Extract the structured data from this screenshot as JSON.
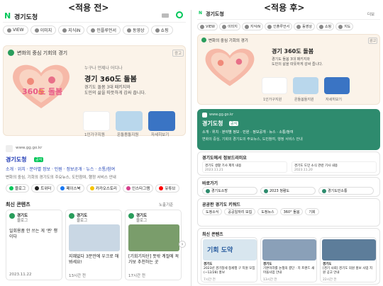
{
  "captions": {
    "before": "<적용 전>",
    "after": "<적용 후>"
  },
  "left": {
    "search": {
      "logo": "N",
      "query": "경기도청"
    },
    "tabs": [
      "VIEW",
      "이미지",
      "지식iN",
      "인플루언서",
      "동영상",
      "쇼핑"
    ],
    "banner": {
      "label": "변화의 중심 기회의 경기",
      "ad": "광고",
      "tagline": "누구나 언제나 어디나",
      "heading": "경기 360도 돌봄",
      "desc": "경기도 돌봄 3대 패키지와\n도민의 삶을 따뜻하게 감싸 줍니다.",
      "art": "360도 돌봄",
      "items": [
        "1인가구지원",
        "온돌봄돌지원",
        "자세히보기"
      ]
    },
    "site": {
      "url": "www.gg.go.kr",
      "name": "경기도청",
      "badge": "공식",
      "links": "소개 · 위치 · 분야별 정보 · 민원 · 정보공개 · 뉴스 · 소통/참여",
      "desc": "변화의 중심, 기회의 경기도의 주요뉴스, 도민참여, 행정 서비스 안내",
      "socials": [
        "블로그",
        "트위터",
        "페이스북",
        "카카오스토리",
        "인스타그램",
        "유튜브"
      ]
    },
    "content": {
      "title": "최신 콘텐츠",
      "more": "노출기준",
      "cards": [
        {
          "source": "경기도",
          "type": "블로그",
          "text": "일회용품 안 쓰는 게 '찐' 챙이다",
          "date": "2023.11.22"
        },
        {
          "source": "경기도",
          "type": "블로그",
          "text": "지혜없다 3분만에 우크로 해봐세요!",
          "date": "13시간 전"
        },
        {
          "source": "경기도",
          "type": "블로그",
          "text": "[기회기자단] 뜻밖 계절에 꼭 가보 추천하는 곳",
          "date": "17시간 전"
        }
      ]
    }
  },
  "right": {
    "search": {
      "logo": "N",
      "query": "경기도청",
      "extra": "더보"
    },
    "tabs": [
      "VIEW",
      "이미지",
      "지식iN",
      "인플루언서",
      "동영상",
      "쇼핑",
      "지도"
    ],
    "banner": {
      "label": "변화의 중심 기회의 경기",
      "ad": "광고",
      "heading": "경기 360도 돌봄",
      "desc": "경기도 돌봄 3대 패키지와\n도민의 삶을 따뜻하게 감싸 줍니다.",
      "items": [
        "1인가구지원",
        "온돌봄돌지원",
        "자세히보기"
      ]
    },
    "site": {
      "url": "www.gg.go.kr",
      "name": "경기도청",
      "badge": "공식",
      "links": "소개 · 위치 · 분야별 정보 · 민원 · 정보공개 · 뉴스 · 소통/참여",
      "desc": "변화의 중심, 기회의 경기도의 주요뉴스, 도민참여, 행정 서비스 안내"
    },
    "news": {
      "title": "경기도에서 정보드리미요",
      "items": [
        {
          "text": "경기도 생활 기사 제목 내용",
          "date": "2023.11.21"
        },
        {
          "text": "경기도 도민 소식 관련 기사 내용",
          "date": "2023.11.20"
        }
      ]
    },
    "shortcuts": {
      "title": "바로가기",
      "items": [
        "경기도소방",
        "2023 청렴도",
        "경기도민소통"
      ]
    },
    "keywords": {
      "title": "공공판 경기도 키워드",
      "items": [
        "도정소식",
        "공공일자리 모집",
        "도정뉴스",
        "360° 돌봄",
        "기회"
      ]
    },
    "content": {
      "title": "최신 콘텐츠",
      "cards": [
        {
          "source": "경기도",
          "text": "2023년 경기청세 청세행 구 지원 모집(~12/28) 홍보",
          "date": "7시간 전",
          "thumb": "기회 도약"
        },
        {
          "source": "경기도",
          "text": "기본이라를 논쟁의 결단 · 치 프랜드 새 마을사업 안내",
          "date": "13시간 전"
        },
        {
          "source": "경기도",
          "text": "[경기 사회] 경기도 의원 홍보 사업 지원 공고 안내",
          "date": "22시간 전"
        }
      ]
    }
  }
}
